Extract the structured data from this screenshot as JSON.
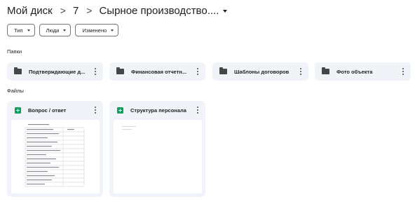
{
  "breadcrumb": {
    "root": "Мой диск",
    "separator": ">",
    "level1": "7",
    "current": "Сырное производство...."
  },
  "filters": [
    {
      "label": "Тип"
    },
    {
      "label": "Люди"
    },
    {
      "label": "Изменено"
    }
  ],
  "sections": {
    "folders": "Папки",
    "files": "Файлы"
  },
  "folders": [
    {
      "name": "Подтверждающие д..."
    },
    {
      "name": "Финансовая отчетн..."
    },
    {
      "name": "Шаблоны договоров"
    },
    {
      "name": "Фото объекта"
    }
  ],
  "files": [
    {
      "name": "Вопрос / ответ",
      "icon": "google-sheets-icon"
    },
    {
      "name": "Структура персонала",
      "icon": "google-sheets-icon"
    }
  ],
  "colors": {
    "card_bg": "#f0f4f9",
    "sheets_green": "#0f9d58",
    "text": "#1f1f1f"
  }
}
